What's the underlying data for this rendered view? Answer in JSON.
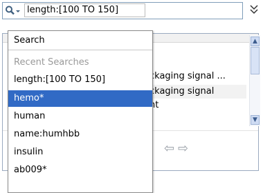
{
  "search": {
    "query": "length:[100 TO 150]",
    "icon": "magnifier-dropdown-icon",
    "expand_icon": "chevron-double-down-icon"
  },
  "dropdown": {
    "search_label": "Search",
    "recent_header": "Recent Searches",
    "recent": [
      "length:[100 TO 150]",
      "hemo*",
      "human",
      "name:humhbb",
      "insulin",
      "ab009*"
    ],
    "selected": "hemo*"
  },
  "results": {
    "rows": [
      "ckaging signal ...",
      "ckaging signal",
      "nt"
    ]
  },
  "colors": {
    "selection": "#316ac5",
    "border": "#7f9db9"
  }
}
